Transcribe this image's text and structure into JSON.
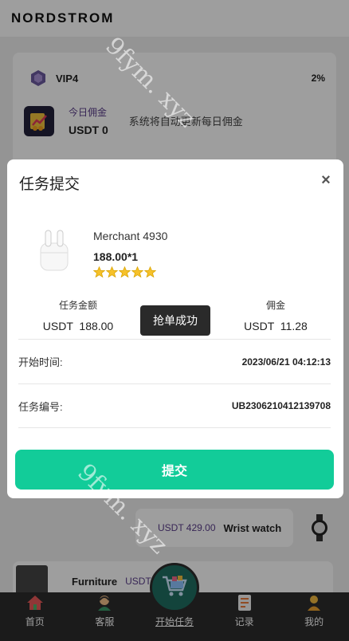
{
  "header": {
    "brand": "NORDSTROM"
  },
  "vip": {
    "level": "VIP4",
    "rate": "2%"
  },
  "commission": {
    "title": "今日佣金",
    "value": "USDT 0",
    "note": "系统将自动更新每日佣金"
  },
  "background_list": [
    {
      "price": "USDT 429.00",
      "name": "Wrist watch"
    },
    {
      "name": "Furniture",
      "price": "USDT"
    }
  ],
  "modal": {
    "title": "任务提交",
    "close_symbol": "×",
    "merchant": "Merchant 4930",
    "price_qty": "188.00*1",
    "rating_stars": 5,
    "amount_label": "任务金额",
    "amount_value": "USDT  188.00",
    "commission_label": "佣金",
    "commission_value": "USDT  11.28",
    "toast": "抢单成功",
    "start_time_label": "开始时间:",
    "start_time_value": "2023/06/21 04:12:13",
    "task_no_label": "任务编号:",
    "task_no_value": "UB2306210412139708",
    "submit_label": "提交"
  },
  "nav": {
    "items": [
      {
        "label": "首页",
        "icon": "home-icon"
      },
      {
        "label": "客服",
        "icon": "support-icon"
      },
      {
        "label": "开始任务",
        "icon": "cart-icon"
      },
      {
        "label": "记录",
        "icon": "record-icon"
      },
      {
        "label": "我的",
        "icon": "profile-icon"
      }
    ]
  },
  "watermark": "9fym. xyz",
  "colors": {
    "accent": "#12cc99",
    "purple_text": "#5a3d8a",
    "nav_bg": "#2c2c2c"
  }
}
